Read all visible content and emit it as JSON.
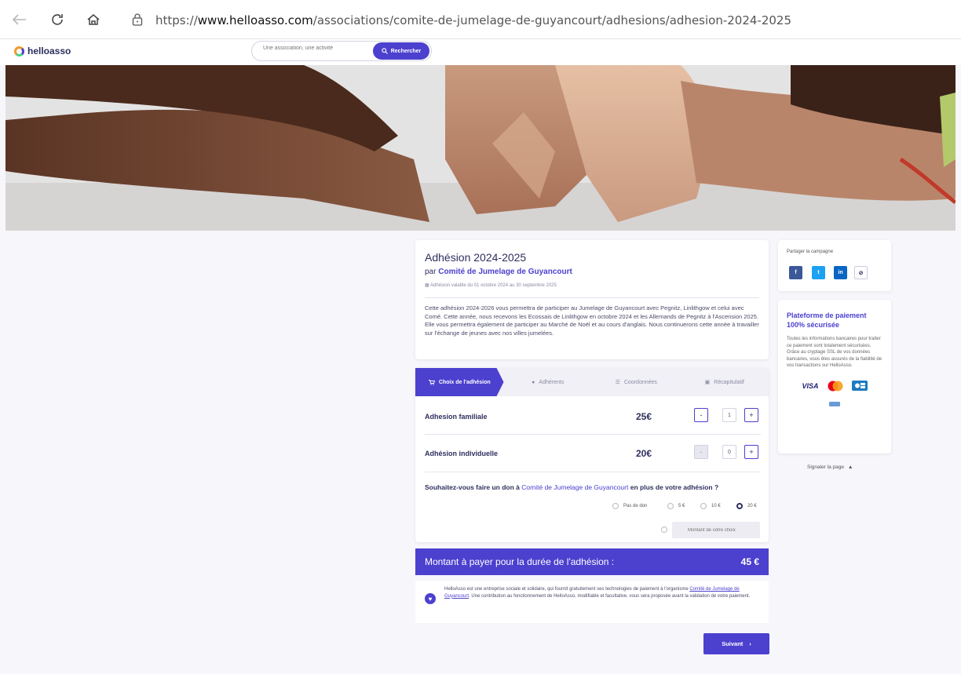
{
  "browser": {
    "url_prefix": "https://",
    "url_domain": "www.helloasso.com",
    "url_path": "/associations/comite-de-jumelage-de-guyancourt/adhesions/adhesion-2024-2025"
  },
  "header": {
    "logo_text": "helloasso",
    "search_placeholder": "Une association, une activité",
    "search_button": "Rechercher"
  },
  "campaign": {
    "title": "Adhésion 2024-2025",
    "by_prefix": "par",
    "organization": "Comité de Jumelage de Guyancourt",
    "validity": "Adhésion valable du 01 octobre 2024 au 30 septembre 2025",
    "description": "Cette adhésion 2024-2026 vous permettra de participer au Jumelage de Guyancourt avec Pegnitz, Linlithgow et celui avec Comé. Cette année, nous recevons les Ecossais de Linlithgow en octobre 2024 et les Allemands de Pegnitz à l'Ascension 2025. Elle vous permettra également de participer au Marché de Noël et au cours d'anglais. Nous continuerons cette année à travailler sur l'échange de jeunes avec nos villes jumelées."
  },
  "steps": [
    {
      "label": "Choix de l'adhésion",
      "icon": "cart-icon"
    },
    {
      "label": "Adhérents",
      "icon": "user-icon"
    },
    {
      "label": "Coordonnées",
      "icon": "list-icon"
    },
    {
      "label": "Récapitulatif",
      "icon": "summary-icon"
    }
  ],
  "options": [
    {
      "label": "Adhesion familiale",
      "price": "25€",
      "quantity": "1"
    },
    {
      "label": "Adhésion individuelle",
      "price": "20€",
      "quantity": "0"
    }
  ],
  "donation": {
    "question_prefix": "Souhaitez-vous faire un don à",
    "question_org": "Comité de Jumelage de Guyancourt",
    "question_suffix": "en plus de votre adhésion ?",
    "choices": [
      "Pas de don",
      "5 €",
      "10 €",
      "20 €"
    ],
    "selected": "20 €",
    "custom_placeholder": "Montant de votre choix"
  },
  "total": {
    "label": "Montant à payer pour la durée de l'adhésion :",
    "amount": "45 €"
  },
  "info": {
    "text_before": "HelloAsso est une entreprise sociale et solidaire, qui fournit gratuitement ses technologies de paiement à l'organisme",
    "org_link": "Comité de Jumelage de Guyancourt",
    "text_after": ". Une contribution au fonctionnement de HelloAsso, modifiable et facultative, vous sera proposée avant la validation de votre paiement."
  },
  "next_button": "Suivant",
  "sidebar": {
    "share_label": "Partager la campagne",
    "social": [
      "f",
      "t",
      "in",
      "link"
    ],
    "secure_title": "Plateforme de paiement 100% sécurisée",
    "secure_text": "Toutes les informations bancaires pour traiter ce paiement sont totalement sécurisées. Grâce au cryptage SSL de vos données bancaires, vous êtes assurés de la fiabilité de vos transactions sur HelloAsso.",
    "visa_label": "VISA",
    "report_label": "Signaler la page"
  },
  "colors": {
    "primary": "#4c40cf",
    "text": "#2e2f5e",
    "facebook": "#3b5998",
    "twitter": "#1da1f2",
    "linkedin": "#0a66c2"
  }
}
